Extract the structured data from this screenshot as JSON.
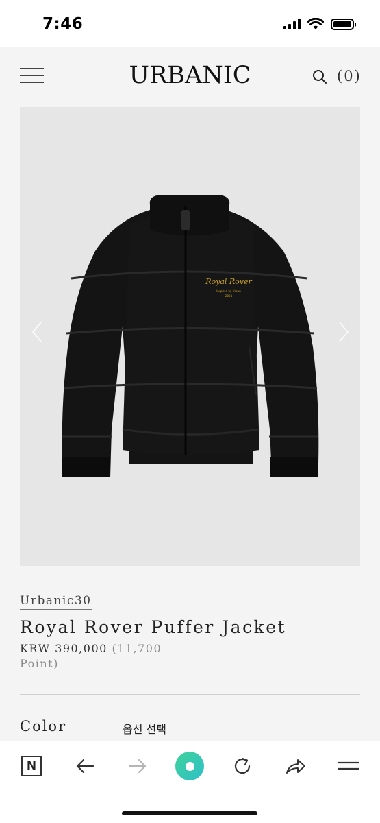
{
  "status_bar": {
    "time": "7:46"
  },
  "header": {
    "logo": "URBANIC",
    "cart_count": "(0)"
  },
  "gallery": {
    "jacket_print_line1": "Royal Rover",
    "jacket_print_line2": "Inspired by Urban",
    "jacket_print_line3": "2024"
  },
  "product": {
    "brand": "Urbanic30",
    "title": "Royal Rover Puffer Jacket",
    "price": "KRW 390,000",
    "points": "(11,700 Point)"
  },
  "options": {
    "color_label": "Color",
    "select_placeholder": "옵션 선택"
  },
  "browser_toolbar": {
    "n_label": "N"
  },
  "colors": {
    "background": "#f4f4f4",
    "image_background": "#e6e6e6",
    "jacket": "#121212",
    "print_gold": "#c9a227",
    "accent_green": "#3fd29a"
  }
}
